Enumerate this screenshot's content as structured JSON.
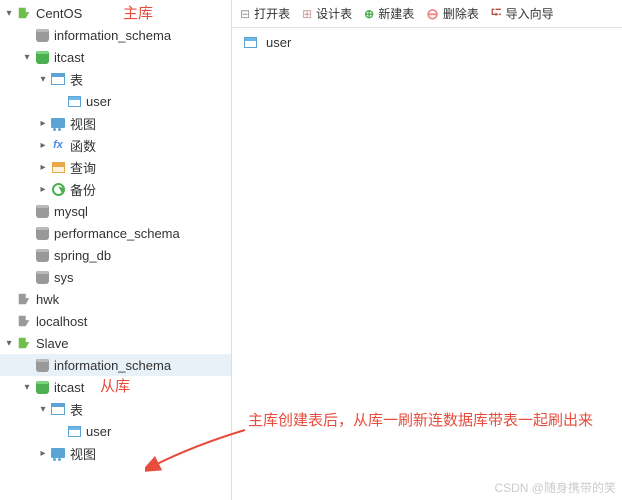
{
  "toolbar": {
    "open": "打开表",
    "design": "设计表",
    "create": "新建表",
    "delete": "删除表",
    "import": "导入向导"
  },
  "content": {
    "item1": "user"
  },
  "tree": {
    "n0": "CentOS",
    "n1": "information_schema",
    "n2": "itcast",
    "n3": "表",
    "n4": "user",
    "n5": "视图",
    "n6": "函数",
    "n7": "查询",
    "n8": "备份",
    "n9": "mysql",
    "n10": "performance_schema",
    "n11": "spring_db",
    "n12": "sys",
    "n13": "hwk",
    "n14": "localhost",
    "n15": "Slave",
    "n16": "information_schema",
    "n17": "itcast",
    "n18": "表",
    "n19": "user",
    "n20": "视图"
  },
  "annotations": {
    "main": "主库",
    "slave": "从库",
    "text": "主库创建表后，从库一刷新连数据库带表一起刷出来"
  },
  "watermark": "CSDN @随身携带的笑"
}
